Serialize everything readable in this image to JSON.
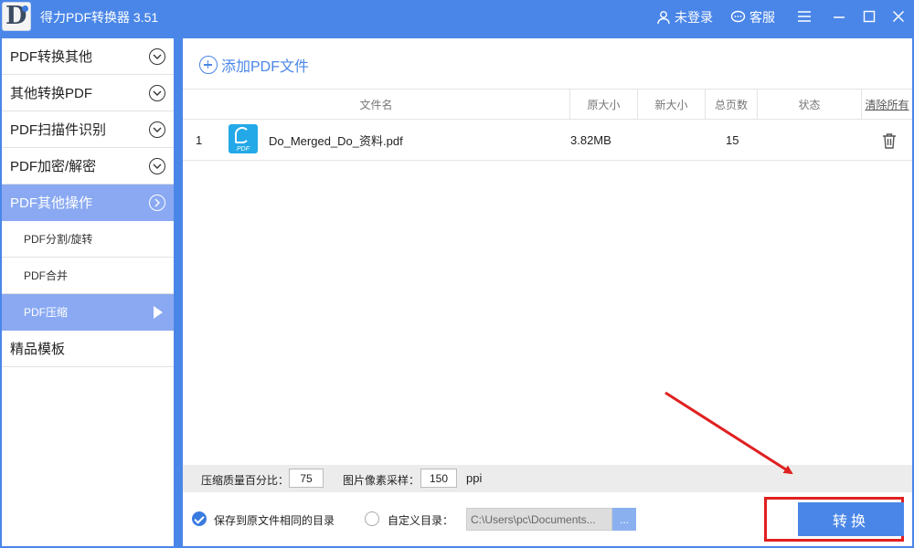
{
  "app": {
    "logo_letter": "D",
    "title": "得力PDF转换器 3.51",
    "user_label": "未登录",
    "service_label": "客服"
  },
  "sidebar": {
    "items": [
      {
        "label": "PDF转换其他"
      },
      {
        "label": "其他转换PDF"
      },
      {
        "label": "PDF扫描件识别"
      },
      {
        "label": "PDF加密/解密"
      },
      {
        "label": "PDF其他操作"
      }
    ],
    "sub_items": [
      {
        "label": "PDF分割/旋转"
      },
      {
        "label": "PDF合并"
      },
      {
        "label": "PDF压缩"
      }
    ],
    "templates_label": "精品模板"
  },
  "main": {
    "add_label": "添加PDF文件",
    "columns": {
      "filename": "文件名",
      "original_size": "原大小",
      "new_size": "新大小",
      "pages": "总页数",
      "status": "状态",
      "clear_all": "清除所有"
    },
    "files": [
      {
        "index": "1",
        "name": "Do_Merged_Do_资料.pdf",
        "original_size": "3.82MB",
        "new_size": "",
        "pages": "15",
        "status": ""
      }
    ],
    "pdf_icon_text": "PDF"
  },
  "settings": {
    "quality_label": "压缩质量百分比：",
    "quality_value": "75",
    "sampling_label": "图片像素采样：",
    "sampling_value": "150",
    "sampling_unit": "ppi"
  },
  "output": {
    "same_dir_label": "保存到原文件相同的目录",
    "custom_dir_label": "自定义目录：",
    "path_value": "C:\\Users\\pc\\Documents...",
    "browse_label": "..."
  },
  "convert_label": "转换",
  "colors": {
    "brand": "#4a86e8",
    "sidebar_active": "#8aa9f2",
    "annotation": "#e02020"
  }
}
